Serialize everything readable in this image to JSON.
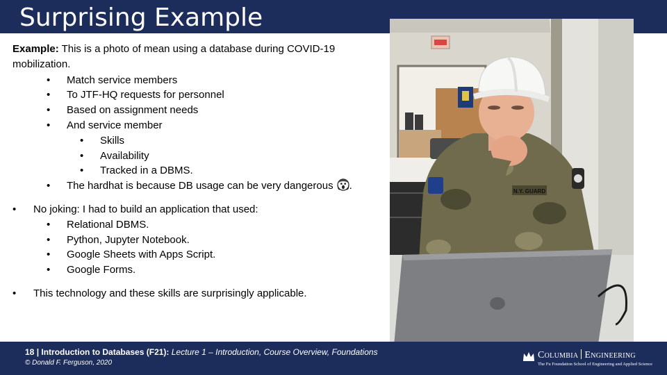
{
  "slide": {
    "title": "Surprising Example",
    "intro_bold": "Example:",
    "intro_text": " This is a photo of mean using a database during COVID-19 mobilization.",
    "bullets_a": [
      "Match service members",
      "To JTF-HQ requests for personnel",
      "Based on assignment needs",
      "And service member"
    ],
    "sub_bullets": [
      "Skills",
      "Availability",
      "Tracked in a DBMS."
    ],
    "hardhat_line": "The hardhat is because DB usage can be very dangerous",
    "hardhat_line_end": ".",
    "no_joking": "No joking: I had to build an application that used:",
    "tech_list": [
      "Relational DBMS.",
      "Python,  Jupyter Notebook.",
      "Google Sheets with Apps Script.",
      "Google Forms."
    ],
    "closing": "This technology and these skills are surprisingly applicable.",
    "bullet_glyph": "•"
  },
  "photo": {
    "patch_text": "N.Y. GUARD"
  },
  "footer": {
    "page_number": "18",
    "separator": " | ",
    "course_bold": "Introduction to Databases (F21):",
    "lecture_italic": " Lecture 1 – Introduction, Course Overview, Foundations",
    "copyright": "© Donald F. Ferguson, 2020"
  },
  "logo": {
    "name_left": "Columbia",
    "name_right": "Engineering",
    "subtitle": "The Fu Foundation School of Engineering and Applied Science"
  },
  "colors": {
    "navy": "#1d2d5b",
    "white": "#ffffff",
    "text": "#000000"
  }
}
